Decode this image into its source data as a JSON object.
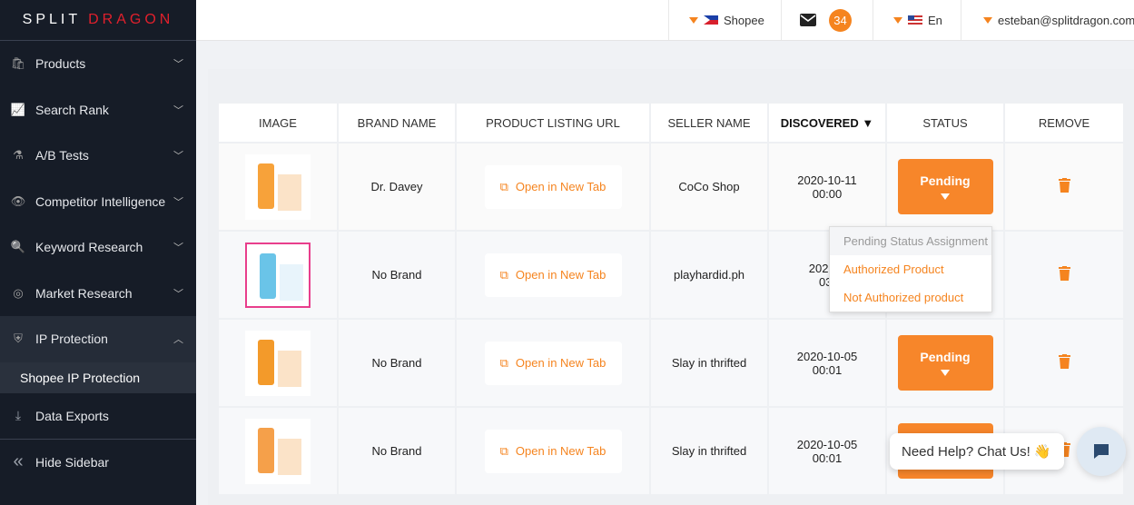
{
  "brand": {
    "logo_part1": "SPLIT",
    "logo_part2": "DRAGON"
  },
  "sidebar": {
    "items": [
      {
        "label": "Products",
        "icon": "bag-icon"
      },
      {
        "label": "Search Rank",
        "icon": "chart-line-icon"
      },
      {
        "label": "A/B Tests",
        "icon": "flask-icon"
      },
      {
        "label": "Competitor Intelligence",
        "icon": "eye-icon"
      },
      {
        "label": "Keyword Research",
        "icon": "search-icon"
      },
      {
        "label": "Market Research",
        "icon": "target-icon"
      },
      {
        "label": "IP Protection",
        "icon": "shield-icon"
      }
    ],
    "sub_item": "Shopee IP Protection",
    "data_exports": "Data Exports",
    "hide": "Hide Sidebar"
  },
  "header": {
    "marketplace": "Shopee",
    "mail_count": "34",
    "language": "En",
    "user": "esteban@splitdragon.com"
  },
  "table": {
    "columns": [
      "IMAGE",
      "BRAND NAME",
      "PRODUCT LISTING URL",
      "SELLER NAME",
      "DISCOVERED ▼",
      "STATUS",
      "REMOVE"
    ],
    "rows": [
      {
        "brand": "Dr. Davey",
        "url": "Open in New Tab",
        "seller": "CoCo Shop",
        "date": "2020-10-11",
        "time": "00:00",
        "status": "Pending"
      },
      {
        "brand": "No Brand",
        "url": "Open in New Tab",
        "seller": "playhardid.ph",
        "date": "2020-1",
        "time": "03:",
        "status": ""
      },
      {
        "brand": "No Brand",
        "url": "Open in New Tab",
        "seller": "Slay in thrifted",
        "date": "2020-10-05",
        "time": "00:01",
        "status": "Pending"
      },
      {
        "brand": "No Brand",
        "url": "Open in New Tab",
        "seller": "Slay in thrifted",
        "date": "2020-10-05",
        "time": "00:01",
        "status": ""
      }
    ]
  },
  "status_menu": {
    "header": "Pending Status Assignment",
    "options": [
      "Authorized Product",
      "Not Authorized product"
    ]
  },
  "chat": {
    "label": "Need Help? Chat Us! 👋"
  },
  "colors": {
    "accent": "#f5841f",
    "sidebar": "#161c27",
    "logo_red": "#e0202c"
  }
}
